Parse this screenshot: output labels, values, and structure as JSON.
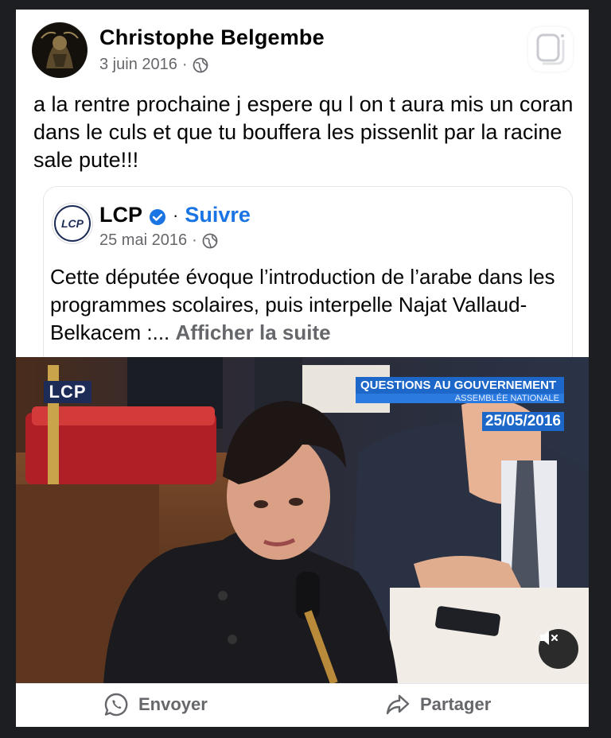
{
  "post": {
    "author": "Christophe Belgembe",
    "date": "3 juin 2016",
    "separator": "·",
    "text": "a la rentre prochaine j espere qu l on t aura mis un coran dans le culs et que tu bouffera les pissenlit par la racine sale pute!!!"
  },
  "shared": {
    "page_name": "LCP",
    "separator": "·",
    "follow_label": "Suivre",
    "date": "25 mai 2016",
    "text": "Cette députée évoque l’introduction de l’arabe dans les programmes scolaires, puis interpelle Najat Vallaud-Belkacem :...",
    "see_more": "Afficher la suite",
    "avatar_text": "LCP"
  },
  "video": {
    "channel_logo": "LCP",
    "overlay_title": "QUESTIONS AU GOUVERNEMENT",
    "overlay_subtitle": "ASSEMBLÉE NATIONALE",
    "overlay_date": "25/05/2016"
  },
  "actions": {
    "send_label": "Envoyer",
    "share_label": "Partager"
  },
  "icons": {
    "privacy": "globe-icon",
    "verified": "verified-badge-icon",
    "mute": "speaker-muted-icon",
    "send": "whatsapp-icon",
    "share": "share-arrow-icon",
    "save": "save-icon"
  },
  "colors": {
    "follow": "#1b74e4",
    "overlay_blue": "#1d67c8",
    "channel_logo_bg": "#1c2c56"
  }
}
